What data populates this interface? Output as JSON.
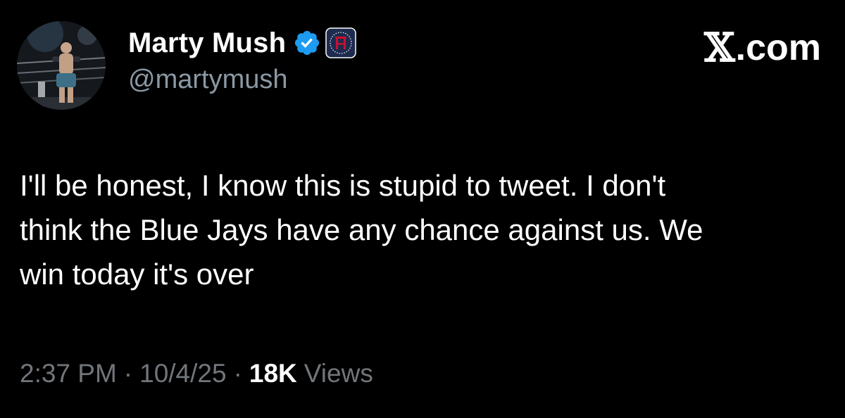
{
  "tweet": {
    "author": {
      "display_name": "Marty Mush",
      "handle": "@martymush",
      "verified": true,
      "affiliate_badge_icon": "barstool-logo-icon",
      "avatar_icon": "avatar-photo"
    },
    "brand": {
      "x_glyph": "𝕏",
      "suffix": ".com"
    },
    "text": "I'll be honest, I know this is stupid to tweet. I don't\nthink the Blue Jays have any chance against us. We\nwin today it's over",
    "time": "2:37 PM",
    "separator": "·",
    "date": "10/4/25",
    "views_count": "18K",
    "views_label": "Views"
  },
  "colors": {
    "background": "#000000",
    "text_primary": "#ffffff",
    "text_secondary": "#71767b",
    "verified_blue": "#1d9bf0"
  }
}
